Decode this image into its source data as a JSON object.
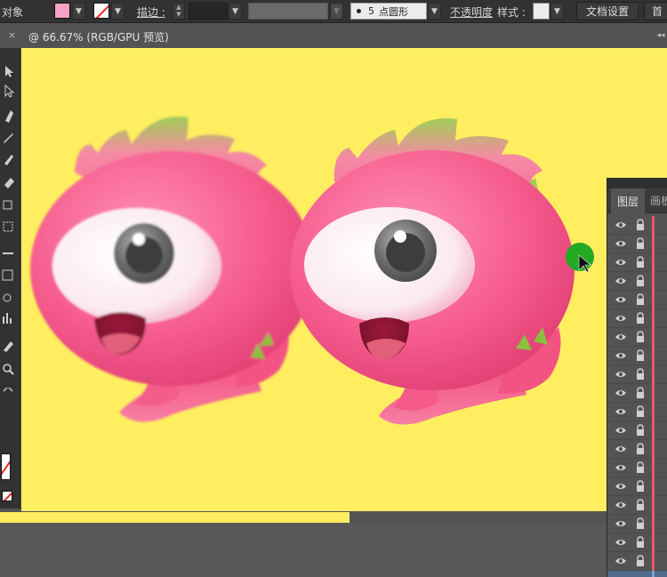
{
  "control_bar": {
    "selection_label": "对象",
    "stroke_label": "描边 :",
    "brush_size": "5",
    "brush_label": "点圆形",
    "opacity_label": "不透明度",
    "style_label": "样式 :",
    "doc_setup_button": "文档设置",
    "prefs_button_partial": "首",
    "fill_color": "#f7a1c4"
  },
  "document": {
    "tab_title": "@ 66.67% (RGB/GPU 预览)",
    "close_glyph": "×",
    "canvas_color": "#ffee60"
  },
  "layers_panel": {
    "tab_layers": "图层",
    "tab_artboards_partial": "画板",
    "row_count": 20,
    "selected_row": 19
  }
}
